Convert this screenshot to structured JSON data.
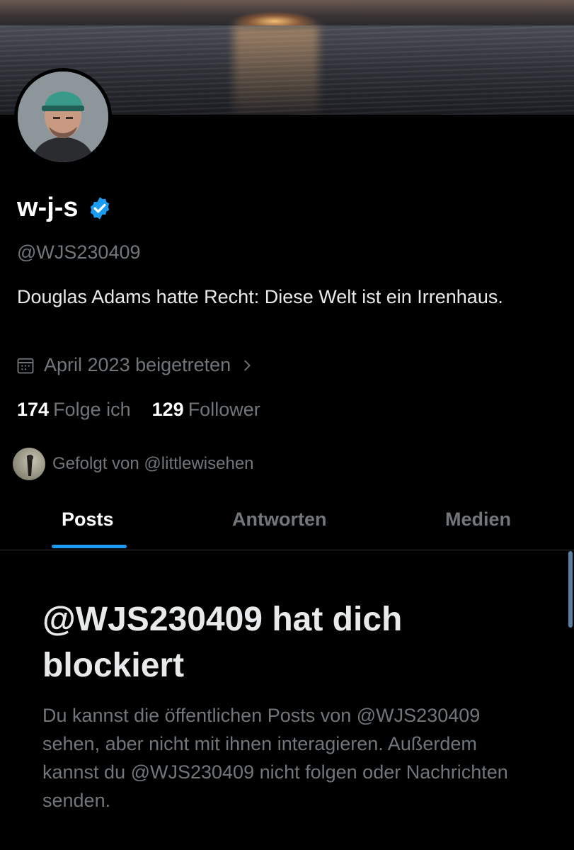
{
  "profile": {
    "display_name": "w-j-s",
    "handle": "@WJS230409",
    "bio": "Douglas Adams hatte Recht: Diese Welt ist ein Irrenhaus.",
    "joined": "April 2023 beigetreten",
    "verified_color": "#1d9bf0"
  },
  "stats": {
    "following_count": "174",
    "following_label": "Folge ich",
    "followers_count": "129",
    "followers_label": "Follower"
  },
  "followed_by": "Gefolgt von @littlewisehen",
  "tabs": [
    {
      "label": "Posts",
      "active": true
    },
    {
      "label": "Antworten",
      "active": false
    },
    {
      "label": "Medien",
      "active": false
    }
  ],
  "blocked": {
    "title": "@WJS230409 hat dich blockiert",
    "message": "Du kannst die öffentlichen Posts von @WJS230409 sehen, aber nicht mit ihnen interagieren. Außerdem kannst du @WJS230409 nicht folgen oder Nachrichten senden."
  },
  "colors": {
    "background": "#000000",
    "accent": "#1d9bf0",
    "muted_text": "#71767b"
  }
}
